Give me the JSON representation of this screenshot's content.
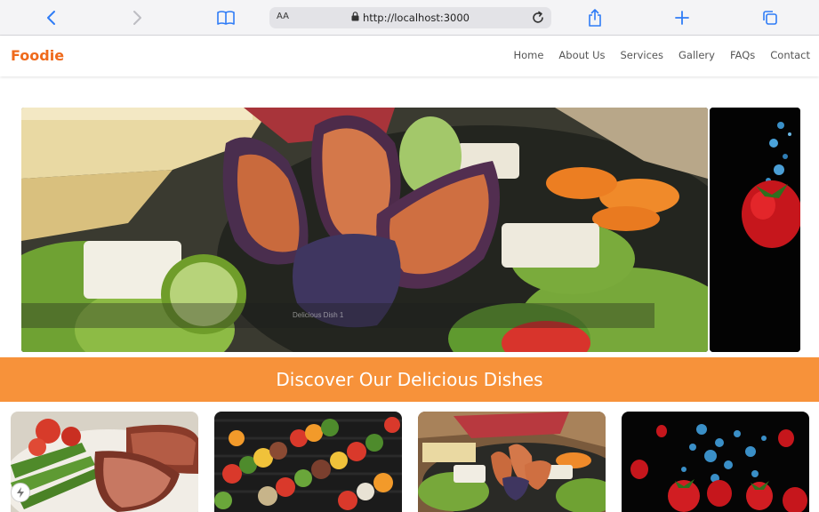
{
  "browser": {
    "text_size_label": "AA",
    "url": "http://localhost:3000"
  },
  "site": {
    "logo": "Foodie",
    "nav": [
      "Home",
      "About Us",
      "Services",
      "Gallery",
      "FAQs",
      "Contact"
    ]
  },
  "hero": {
    "caption": "Delicious Dish 1"
  },
  "banner": {
    "title": "Discover Our Delicious Dishes"
  },
  "colors": {
    "brand": "#ef6a1c",
    "banner": "#f7923a",
    "browser_accent": "#2f7cf6"
  }
}
